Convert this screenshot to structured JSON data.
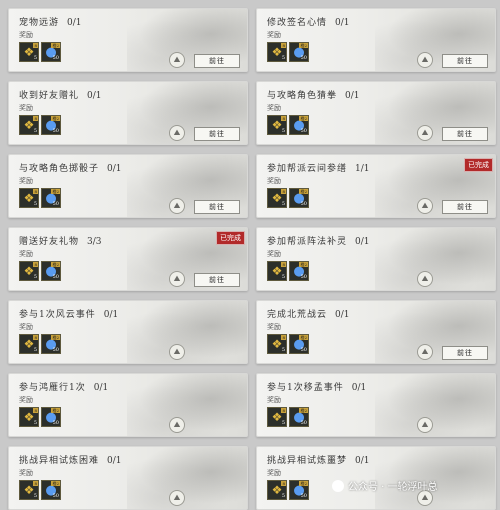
{
  "reward_label": "奖励",
  "goto_label": "前往",
  "done_label": "已完成",
  "tasks": [
    {
      "title": "宠物远游",
      "progress": "0/1",
      "done": false,
      "button": true
    },
    {
      "title": "修改签名心情",
      "progress": "0/1",
      "done": false,
      "button": true
    },
    {
      "title": "收到好友赠礼",
      "progress": "0/1",
      "done": false,
      "button": true
    },
    {
      "title": "与攻略角色猜拳",
      "progress": "0/1",
      "done": false,
      "button": true
    },
    {
      "title": "与攻略角色掷骰子",
      "progress": "0/1",
      "done": false,
      "button": true
    },
    {
      "title": "参加帮派云间参缮",
      "progress": "1/1",
      "done": true,
      "button": true
    },
    {
      "title": "赠送好友礼物",
      "progress": "3/3",
      "done": true,
      "button": true
    },
    {
      "title": "参加帮派阵法补灵",
      "progress": "0/1",
      "done": false,
      "button": false
    },
    {
      "title": "参与1次风云事件",
      "progress": "0/1",
      "done": false,
      "button": false
    },
    {
      "title": "完成北荒战云",
      "progress": "0/1",
      "done": false,
      "button": true
    },
    {
      "title": "参与鸿雁行1次",
      "progress": "0/1",
      "done": false,
      "button": false
    },
    {
      "title": "参与1次移孟事件",
      "progress": "0/1",
      "done": false,
      "button": false
    },
    {
      "title": "挑战异相试炼困难",
      "progress": "0/1",
      "done": false,
      "button": false
    },
    {
      "title": "挑战异相试炼噩梦",
      "progress": "0/1",
      "done": false,
      "button": false
    }
  ],
  "reward_items": [
    {
      "icon": "gold-knot-icon",
      "tag": "8",
      "count": "5"
    },
    {
      "icon": "blue-orb-icon",
      "tag": "橙2",
      "count": "50"
    }
  ],
  "watermark": "公众号 · 一轮浮叶总"
}
